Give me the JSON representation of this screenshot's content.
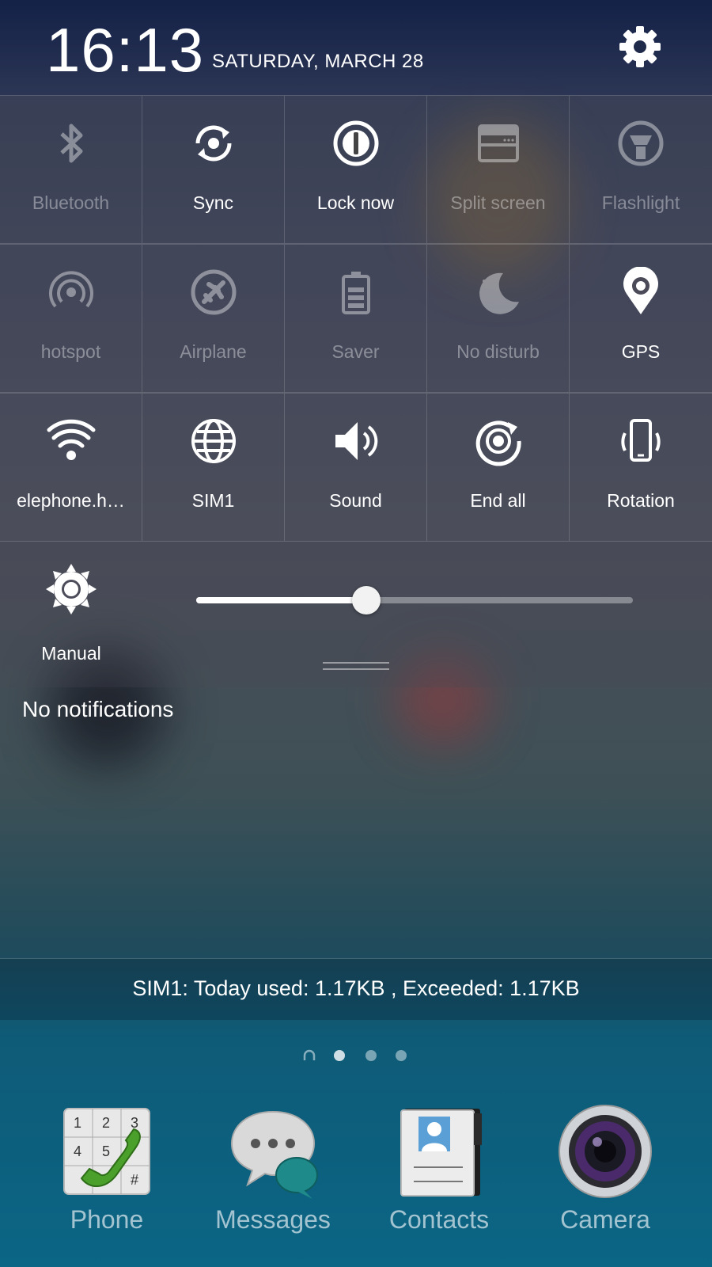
{
  "status": {
    "time": "16:13",
    "date": "SATURDAY, MARCH 28"
  },
  "tiles": [
    {
      "label": "Bluetooth",
      "icon": "bluetooth-icon",
      "active": false
    },
    {
      "label": "Sync",
      "icon": "sync-icon",
      "active": true
    },
    {
      "label": "Lock now",
      "icon": "power-lock-icon",
      "active": true
    },
    {
      "label": "Split screen",
      "icon": "split-screen-icon",
      "active": false
    },
    {
      "label": "Flashlight",
      "icon": "flashlight-icon",
      "active": false
    },
    {
      "label": "hotspot",
      "icon": "hotspot-icon",
      "active": false
    },
    {
      "label": "Airplane",
      "icon": "airplane-icon",
      "active": false
    },
    {
      "label": "Saver",
      "icon": "battery-saver-icon",
      "active": false
    },
    {
      "label": "No disturb",
      "icon": "moon-icon",
      "active": false
    },
    {
      "label": "GPS",
      "icon": "location-pin-icon",
      "active": true
    },
    {
      "label": "elephone.h…",
      "icon": "wifi-icon",
      "active": true
    },
    {
      "label": "SIM1",
      "icon": "globe-icon",
      "active": true
    },
    {
      "label": "Sound",
      "icon": "speaker-icon",
      "active": true
    },
    {
      "label": "End all",
      "icon": "end-all-icon",
      "active": true
    },
    {
      "label": "Rotation",
      "icon": "rotation-icon",
      "active": true
    }
  ],
  "brightness": {
    "label": "Manual",
    "level": 0.39
  },
  "notifications": {
    "empty_text": "No notifications"
  },
  "data_usage": {
    "text": "SIM1: Today used: 1.17KB , Exceeded: 1.17KB"
  },
  "home": {
    "page_count": 3,
    "current_page": 1,
    "dock": [
      {
        "label": "Phone",
        "icon": "phone-dialer-icon"
      },
      {
        "label": "Messages",
        "icon": "messages-icon"
      },
      {
        "label": "Contacts",
        "icon": "contacts-icon"
      },
      {
        "label": "Camera",
        "icon": "camera-icon"
      }
    ]
  },
  "colors": {
    "accent": "#ffffff",
    "dock_bg": "#0b6585"
  }
}
